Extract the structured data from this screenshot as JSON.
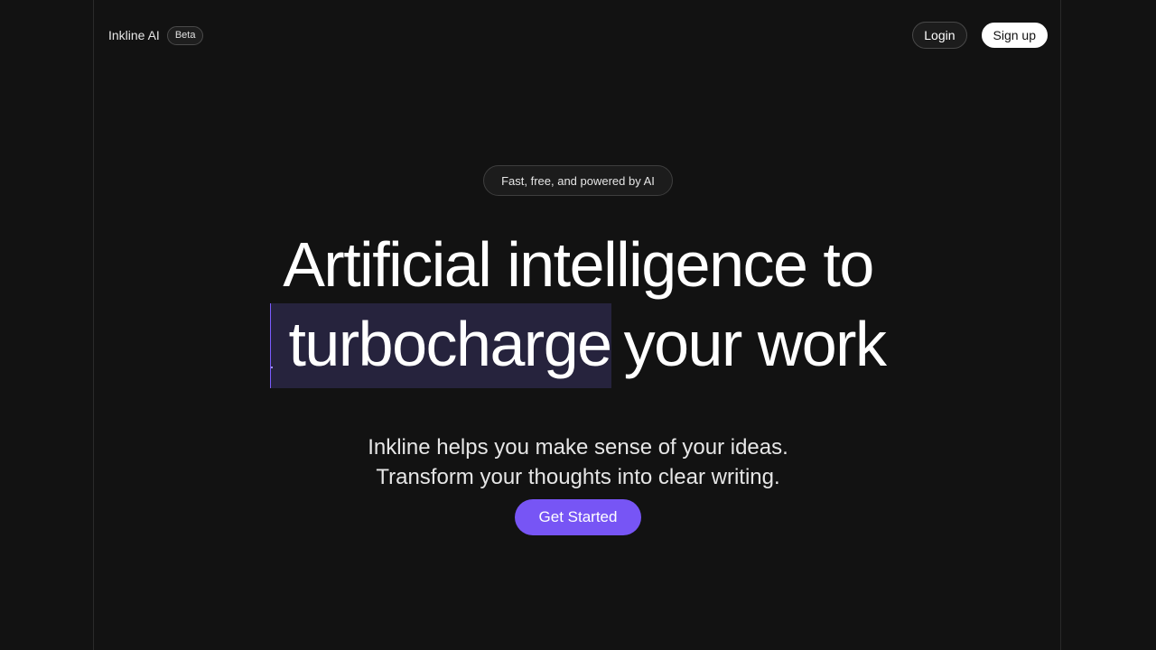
{
  "nav": {
    "brand": "Inkline AI",
    "badge": "Beta",
    "login_label": "Login",
    "signup_label": "Sign up"
  },
  "hero": {
    "tagline": "Fast, free, and powered by AI",
    "headline_line1": "Artificial intelligence to",
    "headline_highlight": "turbocharge",
    "headline_line2_rest": "your work",
    "subhead_line1": "Inkline helps you make sense of your ideas.",
    "subhead_line2": "Transform your thoughts into clear writing.",
    "cta_label": "Get Started"
  },
  "colors": {
    "background": "#121212",
    "accent": "#7755f5",
    "highlight": "#26233d"
  }
}
